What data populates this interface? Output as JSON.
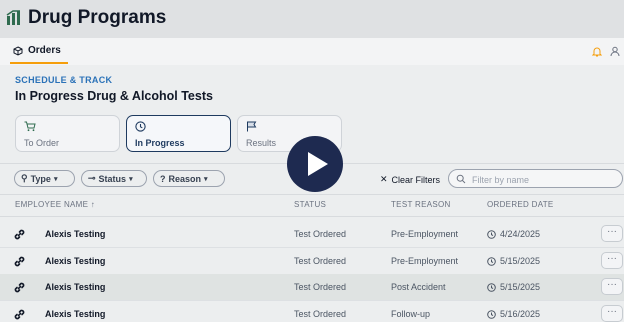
{
  "app": {
    "title": "Drug Programs"
  },
  "subnav": {
    "orders_label": "Orders"
  },
  "page": {
    "eyebrow": "SCHEDULE & TRACK",
    "title": "In Progress Drug & Alcohol Tests"
  },
  "status_cards": [
    {
      "label": "To Order",
      "icon": "cart-icon"
    },
    {
      "label": "In Progress",
      "icon": "clock-icon"
    },
    {
      "label": "Results",
      "icon": "flag-icon"
    }
  ],
  "filters": {
    "type": "Type",
    "status": "Status",
    "reason": "Reason",
    "clear": "Clear Filters",
    "search_placeholder": "Filter by name"
  },
  "table": {
    "columns": [
      "EMPLOYEE NAME",
      "STATUS",
      "TEST REASON",
      "ORDERED DATE"
    ],
    "rows": [
      {
        "name": "Alexis Testing",
        "status": "Test Ordered",
        "reason": "Pre-Employment",
        "date": "4/24/2025"
      },
      {
        "name": "Alexis Testing",
        "status": "Test Ordered",
        "reason": "Pre-Employment",
        "date": "5/15/2025"
      },
      {
        "name": "Alexis Testing",
        "status": "Test Ordered",
        "reason": "Post Accident",
        "date": "5/15/2025"
      },
      {
        "name": "Alexis Testing",
        "status": "Test Ordered",
        "reason": "Follow-up",
        "date": "5/16/2025"
      }
    ],
    "more_label": "···"
  },
  "colors": {
    "accent": "#2b72b8",
    "active_border": "#1e3a5f",
    "tab_underline": "#f59e0b",
    "play_button": "#1e2a50"
  }
}
